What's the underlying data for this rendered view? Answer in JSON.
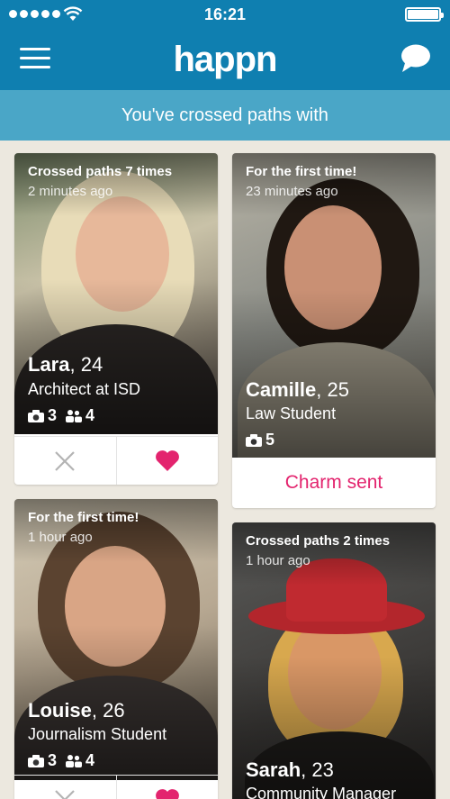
{
  "status_bar": {
    "time": "16:21"
  },
  "nav": {
    "logo": "happn"
  },
  "subheader": "You've crossed paths with",
  "colors": {
    "brand_blue": "#0f7fb0",
    "subheader_blue": "#4aa6c7",
    "charm_pink": "#e3246e"
  },
  "cards": [
    {
      "crossed": "Crossed paths 7 times",
      "ago": "2 minutes ago",
      "name": "Lara",
      "age": ", 24",
      "job": "Architect at ISD",
      "photos": "3",
      "friends": "4",
      "actions": {
        "dismiss_icon": "close-icon",
        "like_icon": "heart-icon"
      }
    },
    {
      "crossed": "For the first time!",
      "ago": "23 minutes ago",
      "name": "Camille",
      "age": ", 25",
      "job": "Law Student",
      "photos": "5",
      "charm": "Charm sent"
    },
    {
      "crossed": "For the first time!",
      "ago": "1 hour ago",
      "name": "Louise",
      "age": ", 26",
      "job": "Journalism Student",
      "photos": "3",
      "friends": "4"
    },
    {
      "crossed": "Crossed paths 2 times",
      "ago": "1 hour ago",
      "name": "Sarah",
      "age": ", 23",
      "job": "Community Manager"
    }
  ]
}
